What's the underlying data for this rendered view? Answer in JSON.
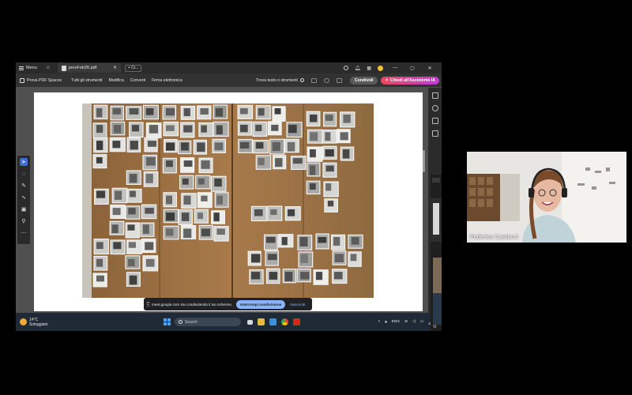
{
  "app": {
    "menu_label": "Menu",
    "doc_tab": "presFeb26.pdf",
    "new_tab_label": "+ Cr..."
  },
  "toolbar": {
    "spaces_label": "Prova PDF Spaces",
    "tools": [
      "Tutti gli strumenti",
      "Modifica",
      "Converti",
      "Firma elettronica"
    ],
    "find_label": "Trova testo o strumenti",
    "share_label": "Condividi",
    "ai_label": "Chiedi all'Assistente IA"
  },
  "share_banner": {
    "message": "meet.google.com sta condividendo il tuo schermo.",
    "stop_label": "Interrompi condivisione",
    "hide_label": "Nascondi"
  },
  "taskbar": {
    "temperature": "14°C",
    "weather": "Soleggiato",
    "search_placeholder": "Search",
    "language": "ENG",
    "time": "4:2",
    "date": "2/18/"
  },
  "screen2": {
    "label": "Vi"
  },
  "video_tile": {
    "participant_name": "Federica Carducci"
  },
  "colors": {
    "ai_gradient_start": "#e84a5f",
    "ai_gradient_end": "#c23ad6",
    "meet_accent": "#8ab4f8",
    "wood": "#9a6f42"
  }
}
